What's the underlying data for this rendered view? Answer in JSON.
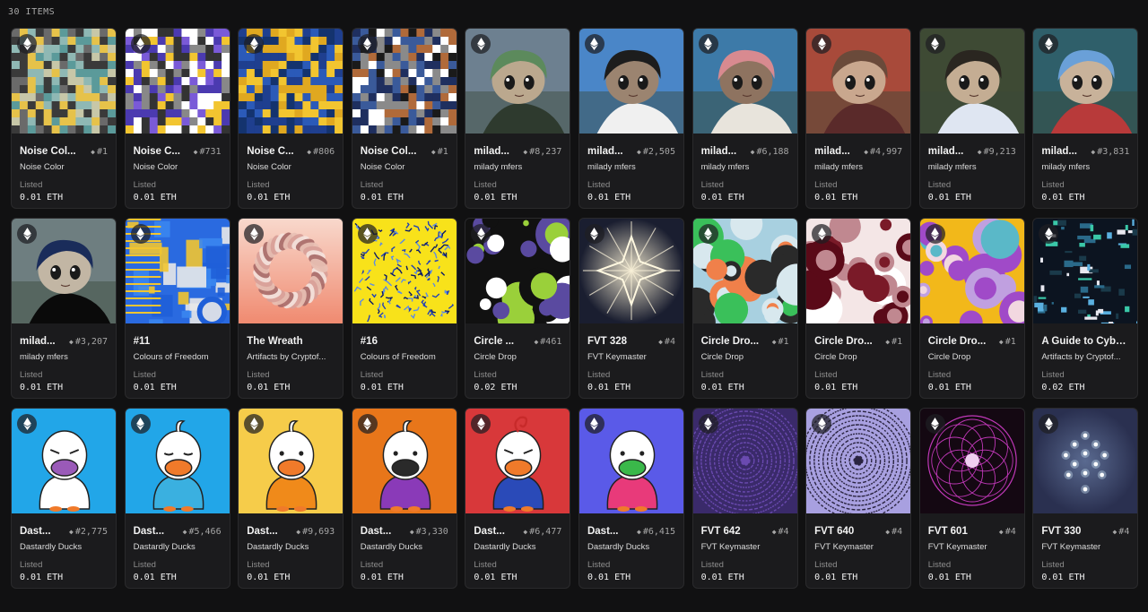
{
  "header": {
    "item_count": "30 ITEMS"
  },
  "chain_icon": "ethereum-icon",
  "listing_status": "Listed",
  "items": [
    {
      "name": "Noise Col...",
      "token": "#1",
      "collection": "Noise Color",
      "price": "0.01 ETH",
      "art": "noise",
      "palette": [
        "#e6c24a",
        "#8fb8b4",
        "#3a3a3a",
        "#6a6a6a",
        "#c7c7a8",
        "#5b9a9a"
      ]
    },
    {
      "name": "Noise C...",
      "token": "#731",
      "collection": "Noise Color",
      "price": "0.01 ETH",
      "art": "noise",
      "palette": [
        "#f2c530",
        "#7a5ad8",
        "#ffffff",
        "#333333",
        "#4b3ab0",
        "#888888"
      ]
    },
    {
      "name": "Noise C...",
      "token": "#806",
      "collection": "Noise Color",
      "price": "0.01 ETH",
      "art": "noise",
      "palette": [
        "#f2c530",
        "#1f3f8f",
        "#2b5ab8",
        "#e0a820",
        "#14336e"
      ]
    },
    {
      "name": "Noise Col...",
      "token": "#1",
      "collection": "Noise Color",
      "price": "0.01 ETH",
      "art": "noise",
      "palette": [
        "#1f2f5f",
        "#ffffff",
        "#b06a3a",
        "#3a5a9a",
        "#8a8a8a",
        "#1a1a1a"
      ]
    },
    {
      "name": "milad...",
      "token": "#8,237",
      "collection": "milady mfers",
      "price": "0.01 ETH",
      "art": "milady",
      "bg": "#6d8090",
      "hair": "#5c8a5c",
      "skin": "#bba88e",
      "acc": "#2e3a2e"
    },
    {
      "name": "milad...",
      "token": "#2,505",
      "collection": "milady mfers",
      "price": "0.01 ETH",
      "art": "milady",
      "bg": "#4a86c8",
      "hair": "#1d1d1d",
      "skin": "#9b8470",
      "acc": "#f0f0f0"
    },
    {
      "name": "milad...",
      "token": "#6,188",
      "collection": "milady mfers",
      "price": "0.01 ETH",
      "art": "milady",
      "bg": "#3d7aa8",
      "hair": "#d88a90",
      "skin": "#8e7360",
      "acc": "#e8e4dc"
    },
    {
      "name": "milad...",
      "token": "#4,997",
      "collection": "milady mfers",
      "price": "0.01 ETH",
      "art": "milady",
      "bg": "#a84a3a",
      "hair": "#6a4a3a",
      "skin": "#c9a78e",
      "acc": "#5a2a2a"
    },
    {
      "name": "milad...",
      "token": "#9,213",
      "collection": "milady mfers",
      "price": "0.01 ETH",
      "art": "milady",
      "bg": "#3e4a34",
      "hair": "#2a2620",
      "skin": "#c4ad93",
      "acc": "#dfe6f2"
    },
    {
      "name": "milad...",
      "token": "#3,831",
      "collection": "milady mfers",
      "price": "0.01 ETH",
      "art": "milady",
      "bg": "#2f5f6a",
      "hair": "#6aa0d8",
      "skin": "#c8b29a",
      "acc": "#b83a3a"
    },
    {
      "name": "milad...",
      "token": "#3,207",
      "collection": "milady mfers",
      "price": "0.01 ETH",
      "art": "milady",
      "bg": "#6e7e80",
      "hair": "#1a2c5a",
      "skin": "#c2b6a4",
      "acc": "#0a0a0a"
    },
    {
      "name": "#11",
      "token": "",
      "collection": "Colours of Freedom",
      "price": "0.01 ETH",
      "art": "blocks",
      "palette": [
        "#1f5fd8",
        "#f2c530",
        "#3a86f0",
        "#e8e8e8"
      ]
    },
    {
      "name": "The Wreath",
      "token": "",
      "collection": "Artifacts by Cryptof...",
      "price": "0.01 ETH",
      "art": "wreath"
    },
    {
      "name": "#16",
      "token": "",
      "collection": "Colours of Freedom",
      "price": "0.01 ETH",
      "art": "scribble"
    },
    {
      "name": "Circle ...",
      "token": "#461",
      "collection": "Circle Drop",
      "price": "0.02 ETH",
      "art": "circles",
      "bg": "#111111",
      "palette": [
        "#9ad03a",
        "#ffffff",
        "#5a4aa0",
        "#111111"
      ]
    },
    {
      "name": "FVT 328",
      "token": "#4",
      "collection": "FVT Keymaster",
      "price": "0.01 ETH",
      "art": "star"
    },
    {
      "name": "Circle Dro...",
      "token": "#1",
      "collection": "Circle Drop",
      "price": "0.01 ETH",
      "art": "circles",
      "bg": "#a8d0e0",
      "palette": [
        "#f0804a",
        "#3ac05a",
        "#2a2a2a",
        "#d8e8ee"
      ]
    },
    {
      "name": "Circle Dro...",
      "token": "#1",
      "collection": "Circle Drop",
      "price": "0.01 ETH",
      "art": "circles",
      "bg": "#f4e6e6",
      "palette": [
        "#7a1a28",
        "#c08890",
        "#ffffff",
        "#5a0a18"
      ]
    },
    {
      "name": "Circle Dro...",
      "token": "#1",
      "collection": "Circle Drop",
      "price": "0.01 ETH",
      "art": "circles",
      "bg": "#f2b81a",
      "palette": [
        "#a04ac8",
        "#5ab8c8",
        "#f2d8e0",
        "#c0a0e0"
      ]
    },
    {
      "name": "A Guide to Cyber...",
      "token": "",
      "collection": "Artifacts by Cryptof...",
      "price": "0.02 ETH",
      "art": "glitch"
    },
    {
      "name": "Dast...",
      "token": "#2,775",
      "collection": "Dastardly Ducks",
      "price": "0.01 ETH",
      "art": "duck",
      "bg": "#22a6e8",
      "beak": "#9a5ab8",
      "shirt": "#ffffff",
      "eyes": "angry",
      "hat": "none"
    },
    {
      "name": "Dast...",
      "token": "#5,466",
      "collection": "Dastardly Ducks",
      "price": "0.01 ETH",
      "art": "duck",
      "bg": "#22a6e8",
      "beak": "#f07a2a",
      "shirt": "#3ab0e0",
      "eyes": "closed",
      "hat": "tuft"
    },
    {
      "name": "Dast...",
      "token": "#9,693",
      "collection": "Dastardly Ducks",
      "price": "0.01 ETH",
      "art": "duck",
      "bg": "#f6cc4a",
      "beak": "#f07a2a",
      "shirt": "#f08a1a",
      "eyes": "dot",
      "hat": "tuft"
    },
    {
      "name": "Dast...",
      "token": "#3,330",
      "collection": "Dastardly Ducks",
      "price": "0.01 ETH",
      "art": "duck",
      "bg": "#e8761a",
      "beak": "#2a2a2a",
      "shirt": "#8a3ab8",
      "eyes": "dot",
      "hat": "tuft"
    },
    {
      "name": "Dast...",
      "token": "#6,477",
      "collection": "Dastardly Ducks",
      "price": "0.01 ETH",
      "art": "duck",
      "bg": "#d8383a",
      "beak": "#f07a2a",
      "shirt": "#2a4ab8",
      "eyes": "angry",
      "hat": "swirl"
    },
    {
      "name": "Dast...",
      "token": "#6,415",
      "collection": "Dastardly Ducks",
      "price": "0.01 ETH",
      "art": "duck",
      "bg": "#5a5ae8",
      "beak": "#3ab84a",
      "shirt": "#e83a7a",
      "eyes": "dot",
      "hat": "none"
    },
    {
      "name": "FVT 642",
      "token": "#4",
      "collection": "FVT Keymaster",
      "price": "0.01 ETH",
      "art": "rings",
      "bg": "#3a2a6a",
      "stroke": "#6a4ab0"
    },
    {
      "name": "FVT 640",
      "token": "#4",
      "collection": "FVT Keymaster",
      "price": "0.01 ETH",
      "art": "rings",
      "bg": "#a8a0e0",
      "stroke": "#2a2440"
    },
    {
      "name": "FVT 601",
      "token": "#4",
      "collection": "FVT Keymaster",
      "price": "0.01 ETH",
      "art": "mandala",
      "bg": "#140812",
      "stroke": "#c038b8"
    },
    {
      "name": "FVT 330",
      "token": "#4",
      "collection": "FVT Keymaster",
      "price": "0.01 ETH",
      "art": "lights",
      "bg": "#2a3050",
      "stroke": "#d8f0ff"
    }
  ]
}
